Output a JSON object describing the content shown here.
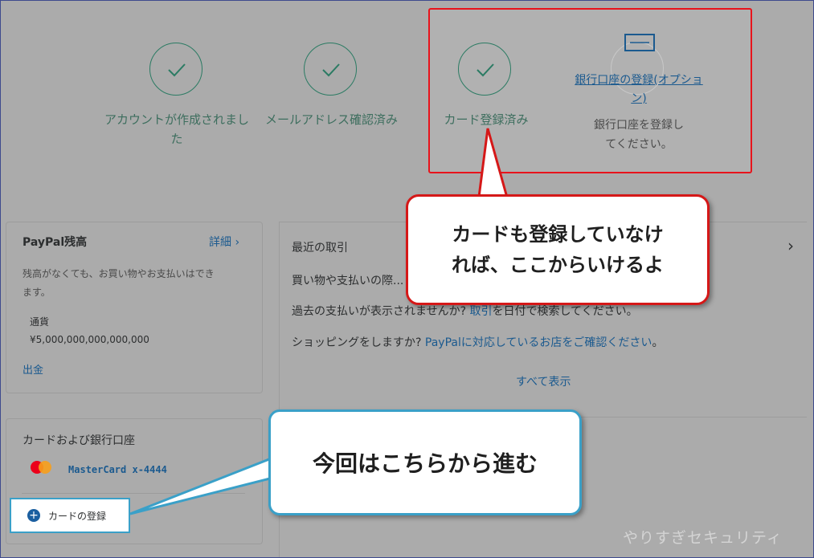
{
  "steps": [
    {
      "label_line1": "アカウントが作成されまし",
      "label_line2": "た"
    },
    {
      "label_line1": "メールアドレス確認済み"
    },
    {
      "label_line1": "カード登録済み"
    }
  ],
  "bank_step": {
    "link_line1": "銀行口座の登録(オプショ",
    "link_line2": "ン)",
    "desc_line1": "銀行口座を登録し",
    "desc_line2": "てください。"
  },
  "balance": {
    "title": "PayPal残高",
    "detail_link": "詳細 ›",
    "desc_line1": "残高がなくても、お買い物やお支払いはでき",
    "desc_line2": "ます。",
    "currency_label": "通貨",
    "amount": "¥5,000,000,000,000,000",
    "withdraw": "出金"
  },
  "transactions": {
    "title": "最近の取引",
    "line1": "買い物や支払いの際...",
    "line2_pre": "過去の支払いが表示されませんか? ",
    "line2_link": "取引",
    "line2_post": "を日付で検索してください。",
    "line3_pre": "ショッピングをしますか? ",
    "line3_link": "PayPalに対応しているお店をご確認ください",
    "line3_post": "。",
    "show_all": "すべて表示"
  },
  "cards": {
    "title": "カードおよび銀行口座",
    "card_name": "MasterCard x-4444",
    "add_button": "カードの登録"
  },
  "annotations": {
    "bubble_red_line1": "カードも登録していなけ",
    "bubble_red_line2": "れば、ここからいけるよ",
    "bubble_blue": "今回はこちらから進む"
  },
  "watermark": "やりすぎセキュリティ",
  "colors": {
    "accent_red": "#e8131b",
    "accent_blue": "#3aa0c8",
    "link": "#1b5a8f",
    "check_green": "#2b7b63"
  }
}
